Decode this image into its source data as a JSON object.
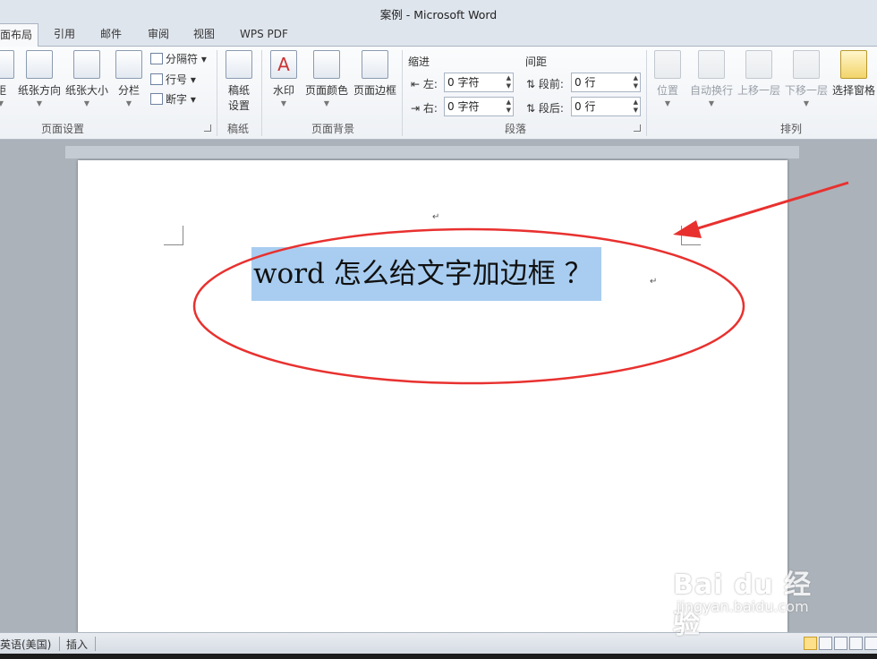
{
  "title": "案例 - Microsoft Word",
  "tabs": [
    {
      "label": "面布局",
      "active": true
    },
    {
      "label": "引用"
    },
    {
      "label": "邮件"
    },
    {
      "label": "审阅"
    },
    {
      "label": "视图"
    },
    {
      "label": "WPS PDF"
    }
  ],
  "ribbon": {
    "page_setup": {
      "label": "页面设置",
      "margins": "距",
      "orientation": "纸张方向",
      "size": "纸张大小",
      "columns": "分栏",
      "breaks": "分隔符",
      "line_numbers": "行号",
      "hyphenation": "断字"
    },
    "manuscript": {
      "label": "稿纸",
      "button_line1": "稿纸",
      "button_line2": "设置"
    },
    "page_background": {
      "label": "页面背景",
      "watermark": "水印",
      "page_color": "页面颜色",
      "page_border": "页面边框"
    },
    "paragraph": {
      "label": "段落",
      "indent_title": "缩进",
      "indent_left_label": "左:",
      "indent_left_value": "0 字符",
      "indent_right_label": "右:",
      "indent_right_value": "0 字符",
      "spacing_title": "间距",
      "before_label": "段前:",
      "before_value": "0 行",
      "after_label": "段后:",
      "after_value": "0 行"
    },
    "arrange": {
      "label": "排列",
      "position": "位置",
      "wrap": "自动换行",
      "bring_forward": "上移一层",
      "send_backward": "下移一层",
      "selection_pane": "选择窗格"
    }
  },
  "document": {
    "text": "word 怎么给文字加边框 ？",
    "paragraph_mark": "↵"
  },
  "status": {
    "language": "英语(美国)",
    "mode": "插入"
  },
  "watermark": {
    "brand": "Bai du 经验",
    "url": "jingyan.baidu.com"
  },
  "colors": {
    "annotation": "#e8312f",
    "selection": "#a8cdf0"
  }
}
